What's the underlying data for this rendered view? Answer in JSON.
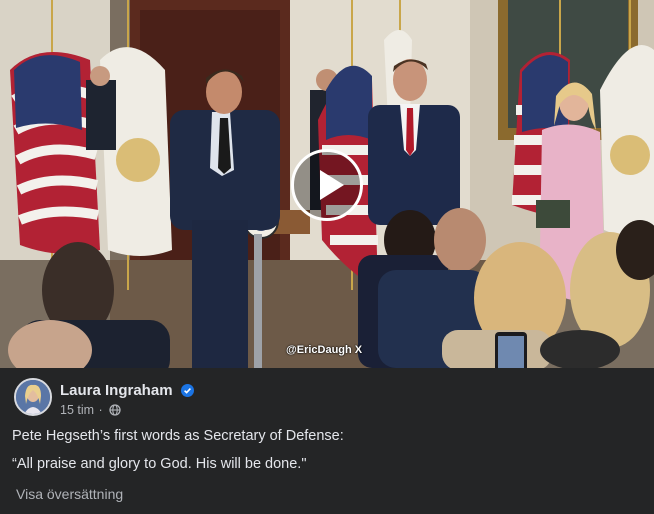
{
  "video": {
    "watermark_handle": "@EricDaugh",
    "watermark_x": "X"
  },
  "post": {
    "author": "Laura Ingraham",
    "time": "15 tim",
    "separator": "·",
    "text_line_1": "Pete Hegseth’s first words as Secretary of Defense:",
    "text_line_2": "“All praise and glory to God. His will be done.\"",
    "translate_link": "Visa översättning"
  },
  "icons": {
    "play": "play-icon",
    "verified": "verified-badge-icon",
    "audience": "globe-icon"
  },
  "colors": {
    "background": "#242526",
    "text_primary": "#e4e6eb",
    "text_secondary": "#b0b3b8",
    "verified_blue": "#1b74e4"
  }
}
